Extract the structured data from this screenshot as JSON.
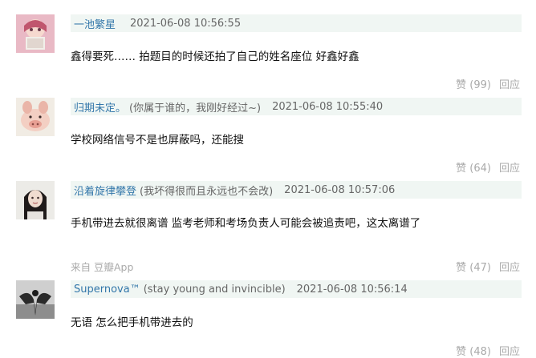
{
  "comments": [
    {
      "author": "一池繁星",
      "signature": "",
      "time": "2021-06-08 10:56:55",
      "text": "鑫得要死…… 拍题目的时候还拍了自己的姓名座位 好鑫好鑫",
      "source": "",
      "likes": "赞 (99)",
      "reply": "回应"
    },
    {
      "author": "归期未定。",
      "signature": "(你属于谁的，我刚好经过~)",
      "time": "2021-06-08 10:55:40",
      "text": "学校网络信号不是也屏蔽吗，还能搜",
      "source": "",
      "likes": "赞 (64)",
      "reply": "回应"
    },
    {
      "author": "沿着旋律攀登",
      "signature": "(我坏得很而且永远也不会改)",
      "time": "2021-06-08 10:57:06",
      "text": "手机带进去就很离谱 监考老师和考场负责人可能会被追责吧，这太离谱了",
      "source": "来自 豆瓣App",
      "likes": "赞 (47)",
      "reply": "回应"
    },
    {
      "author": "Supernova™",
      "signature": "(stay young and invincible)",
      "time": "2021-06-08 10:56:14",
      "text": "无语 怎么把手机带进去的",
      "source": "",
      "likes": "赞 (48)",
      "reply": "回应"
    }
  ]
}
